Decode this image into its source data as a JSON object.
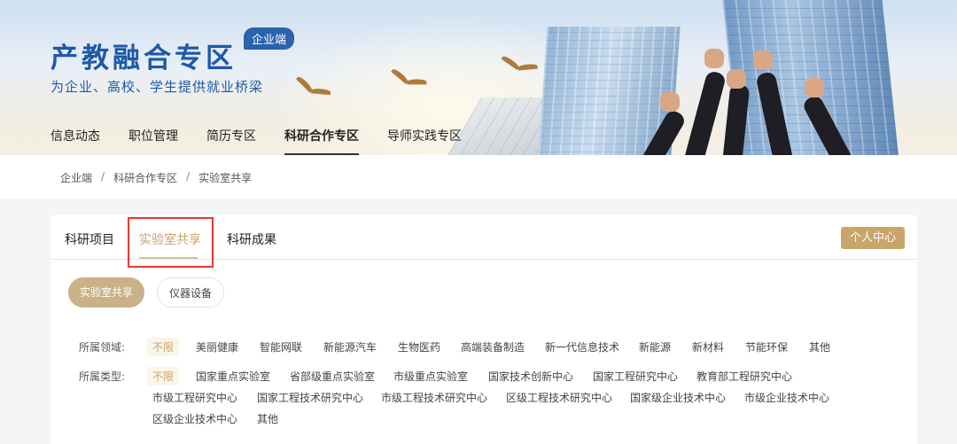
{
  "header": {
    "title": "产教融合专区",
    "badge": "企业端",
    "subtitle": "为企业、高校、学生提供就业桥梁",
    "nav": [
      {
        "label": "信息动态",
        "active": false
      },
      {
        "label": "职位管理",
        "active": false
      },
      {
        "label": "简历专区",
        "active": false
      },
      {
        "label": "科研合作专区",
        "active": true
      },
      {
        "label": "导师实践专区",
        "active": false
      }
    ]
  },
  "breadcrumb": [
    "企业端",
    "科研合作专区",
    "实验室共享"
  ],
  "breadcrumb_sep": "/",
  "tabs": [
    {
      "label": "科研项目",
      "active": false
    },
    {
      "label": "实验室共享",
      "active": true
    },
    {
      "label": "科研成果",
      "active": false
    }
  ],
  "personal_center": "个人中心",
  "sub_tabs": [
    {
      "label": "实验室共享",
      "active": true
    },
    {
      "label": "仪器设备",
      "active": false
    }
  ],
  "filters": {
    "field": {
      "label": "所属领域:",
      "options": [
        "不限",
        "美丽健康",
        "智能网联",
        "新能源汽车",
        "生物医药",
        "高端装备制造",
        "新一代信息技术",
        "新能源",
        "新材料",
        "节能环保",
        "其他"
      ],
      "selected": "不限"
    },
    "type": {
      "label": "所属类型:",
      "options": [
        "不限",
        "国家重点实验室",
        "省部级重点实验室",
        "市级重点实验室",
        "国家技术创新中心",
        "国家工程研究中心",
        "教育部工程研究中心",
        "市级工程研究中心",
        "国家工程技术研究中心",
        "市级工程技术研究中心",
        "区级工程技术研究中心",
        "国家级企业技术中心",
        "市级企业技术中心",
        "区级企业技术中心",
        "其他"
      ],
      "selected": "不限"
    }
  },
  "colors": {
    "brand_blue": "#1d5aa8",
    "accent_gold": "#c9a56a",
    "highlight_red": "#e53935"
  }
}
